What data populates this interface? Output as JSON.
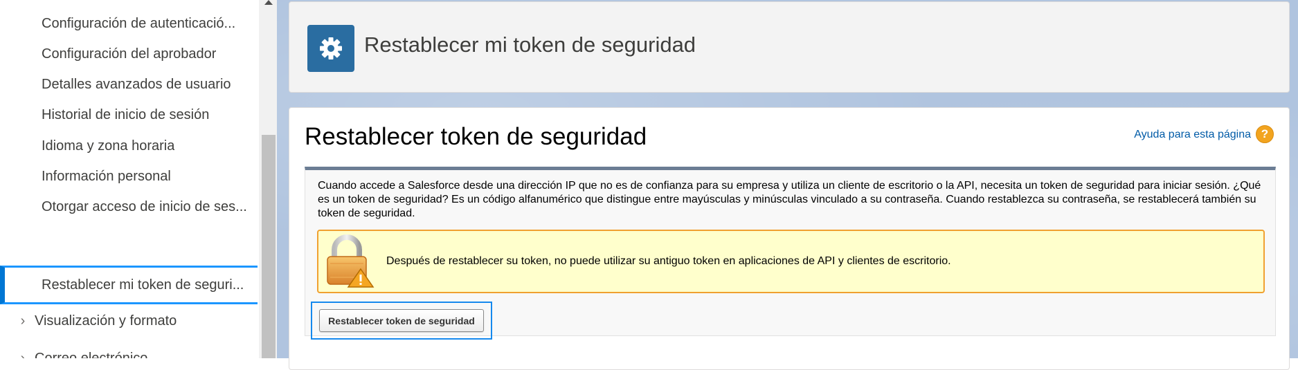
{
  "sidebar": {
    "items": [
      {
        "label": "Configuración de autenticació..."
      },
      {
        "label": "Configuración del aprobador"
      },
      {
        "label": "Detalles avanzados de usuario"
      },
      {
        "label": "Historial de inicio de sesión"
      },
      {
        "label": "Idioma y zona horaria"
      },
      {
        "label": "Información personal"
      },
      {
        "label": "Otorgar acceso de inicio de ses..."
      },
      {
        "label": "Restablecer mi token de seguri..."
      }
    ],
    "groups": [
      {
        "label": "Visualización y formato"
      },
      {
        "label": "Correo electrónico"
      }
    ]
  },
  "header": {
    "title": "Restablecer mi token de seguridad",
    "icon": "gear-icon",
    "icon_bg": "#2a6da1"
  },
  "content": {
    "page_title": "Restablecer token de seguridad",
    "help_link": "Ayuda para esta página",
    "help_icon_text": "?",
    "description": "Cuando accede a Salesforce desde una dirección IP que no es de confianza para su empresa y utiliza un cliente de escritorio o la API, necesita un token de seguridad para iniciar sesión. ¿Qué es un token de seguridad? Es un código alfanumérico que distingue entre mayúsculas y minúsculas vinculado a su contraseña. Cuando restablezca su contraseña, se restablecerá también su token de seguridad.",
    "warning": "Después de restablecer su token, no puede utilizar su antiguo token en aplicaciones de API y clientes de escritorio.",
    "button_label": "Restablecer token de seguridad"
  },
  "colors": {
    "active_nav": "#0176d3",
    "link": "#015ba7",
    "warning_bg": "#ffffcc",
    "warning_border": "#f0a030",
    "focus_ring": "#1589ee"
  }
}
